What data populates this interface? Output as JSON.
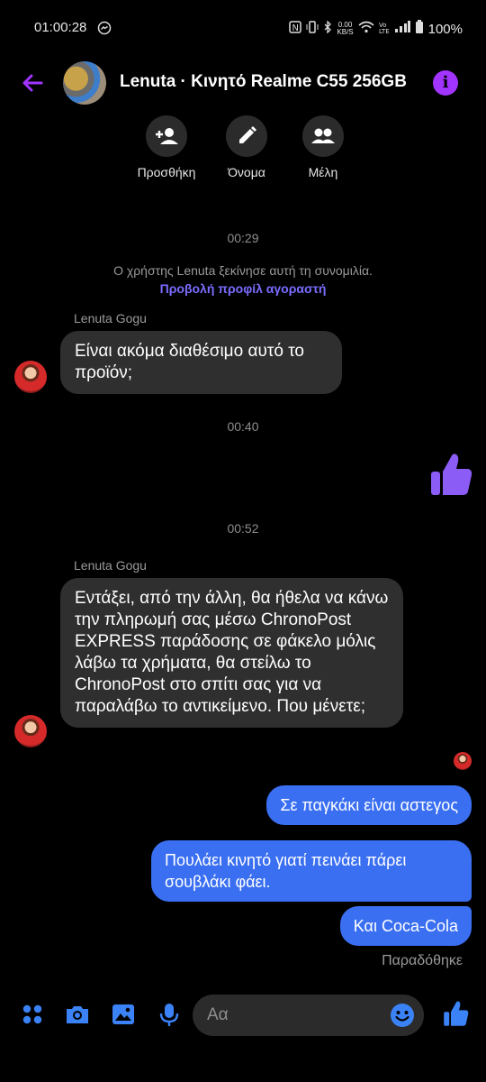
{
  "status_bar": {
    "time": "01:00:28",
    "net_speed_top": "0.00",
    "net_speed_unit": "KB/S",
    "battery": "100%"
  },
  "header": {
    "title": "Lenuta · Κινητό Realme C55 256GB",
    "actions": [
      {
        "label": "Προσθήκη",
        "icon": "add-person-icon"
      },
      {
        "label": "Όνομα",
        "icon": "pencil-icon"
      },
      {
        "label": "Μέλη",
        "icon": "members-icon"
      }
    ]
  },
  "conversation": {
    "time_1": "00:29",
    "system_text": "Ο χρήστης Lenuta ξεκίνησε αυτή τη συνομιλία.",
    "system_link": "Προβολή προφίλ αγοραστή",
    "sender_1": "Lenuta Gogu",
    "incoming_1": "Είναι ακόμα διαθέσιμο αυτό το προϊόν;",
    "time_2": "00:40",
    "time_3": "00:52",
    "sender_2": "Lenuta Gogu",
    "incoming_2": "Εντάξει, από την άλλη, θα ήθελα να κάνω την πληρωμή σας μέσω ChronoPost EXPRESS παράδοσης σε φάκελο μόλις λάβω τα χρήματα, θα στείλω το ChronoPost στο σπίτι σας για να παραλάβω το αντικείμενο. Που μένετε;",
    "outgoing_1": "Σε παγκάκι είναι αστεγος",
    "outgoing_2": "Πουλάει κινητό γιατί πεινάει πάρει σουβλάκι φάει.",
    "outgoing_3": "Και Coca-Cola",
    "delivered": "Παραδόθηκε"
  },
  "composer": {
    "placeholder": "Αα"
  },
  "colors": {
    "accent": "#a234ff",
    "outgoing_bubble": "#3a6ff2",
    "incoming_bubble": "#2f2f2f",
    "composer_icons": "#3b82f6",
    "thumbs_up": "#8b5cf6"
  }
}
